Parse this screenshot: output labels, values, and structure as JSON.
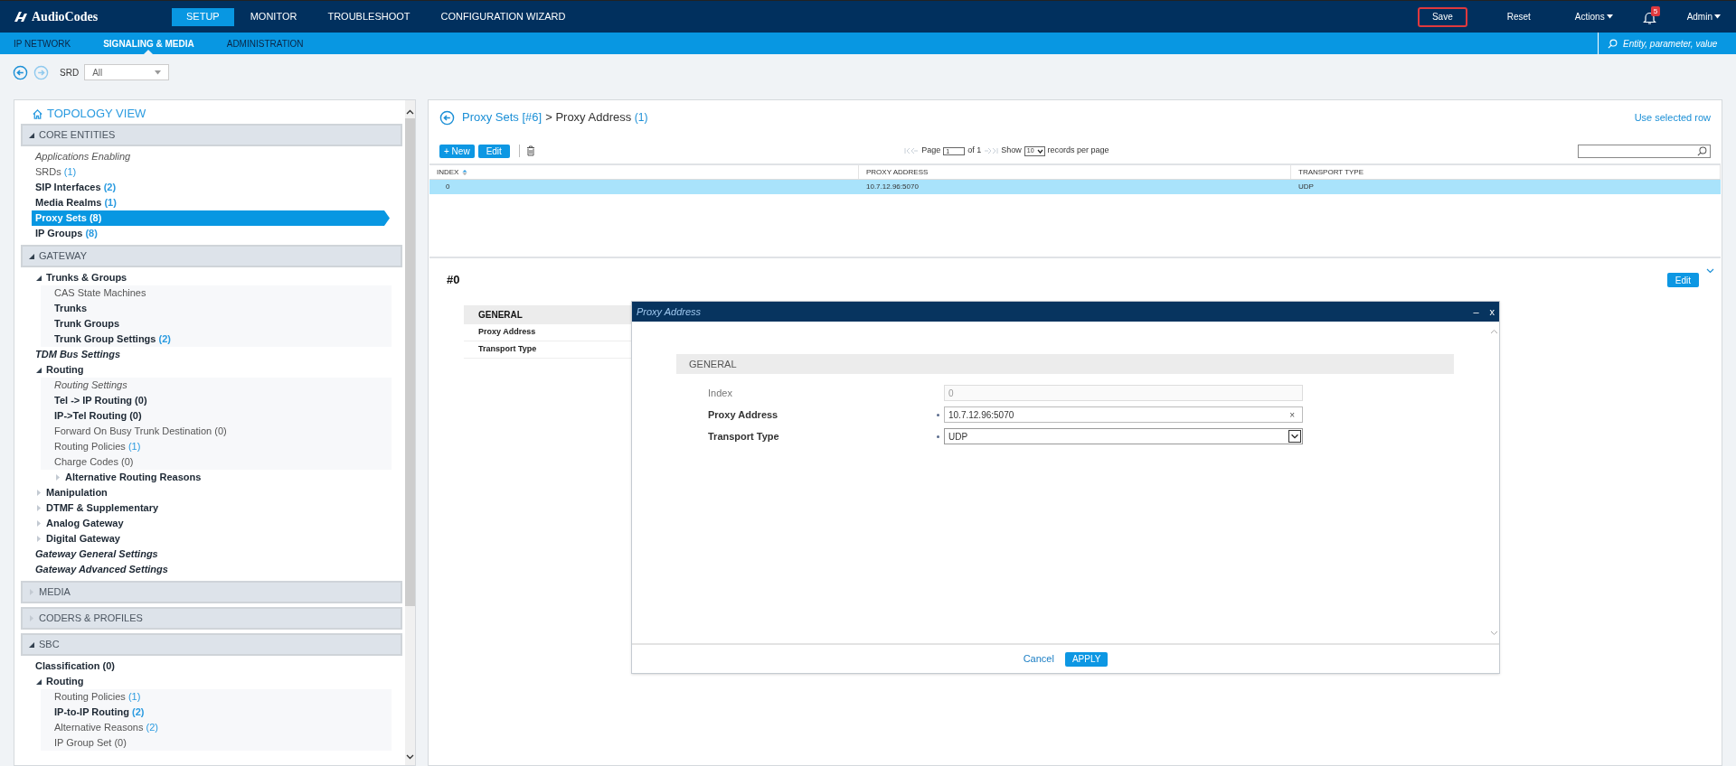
{
  "top_bar": {
    "logo": "AudioCodes",
    "tabs": [
      {
        "label": "SETUP",
        "selected": true
      },
      {
        "label": "MONITOR",
        "selected": false
      },
      {
        "label": "TROUBLESHOOT",
        "selected": false
      },
      {
        "label": "CONFIGURATION WIZARD",
        "selected": false
      }
    ],
    "actions": [
      {
        "label": "Save",
        "kind": "button",
        "outlined": true
      },
      {
        "label": "Reset",
        "kind": "button",
        "outlined": false
      },
      {
        "label": "Actions",
        "kind": "menu",
        "outlined": false
      },
      {
        "label": "5",
        "kind": "bell",
        "outlined": false
      },
      {
        "label": "Admin",
        "kind": "menu",
        "outlined": false
      }
    ]
  },
  "sub_nav": {
    "tabs": [
      {
        "label": "IP NETWORK",
        "selected": false
      },
      {
        "label": "SIGNALING & MEDIA",
        "selected": true
      },
      {
        "label": "ADMINISTRATION",
        "selected": false
      }
    ],
    "search": {
      "placeholder": "Entity, parameter, value"
    }
  },
  "toolbar": {
    "srd_label": "SRD",
    "srd_value": "All"
  },
  "sidebar": {
    "title": "TOPOLOGY VIEW",
    "sections": [
      {
        "label": "CORE ENTITIES",
        "expanded": true,
        "items": [
          {
            "label": "Applications Enabling",
            "kind": "page",
            "selected": false
          },
          {
            "label": "SRDs",
            "count": "(1)",
            "kind": "item",
            "selected": false
          },
          {
            "label": "SIP Interfaces",
            "count": "(2)",
            "kind": "table",
            "selected": false
          },
          {
            "label": "Media Realms",
            "count": "(1)",
            "kind": "table",
            "selected": false
          },
          {
            "label": "Proxy Sets",
            "count": "(8)",
            "kind": "table",
            "selected": true
          },
          {
            "label": "IP Groups",
            "count": "(8)",
            "kind": "table",
            "selected": false
          }
        ]
      },
      {
        "label": "GATEWAY",
        "expanded": true,
        "items": [
          {
            "label": "Trunks & Groups",
            "kind": "table",
            "selected": false,
            "expanded": true,
            "children": [
              {
                "label": "CAS State Machines",
                "kind": "item",
                "selected": false
              },
              {
                "label": "Trunks",
                "kind": "table",
                "selected": false
              },
              {
                "label": "Trunk Groups",
                "kind": "table",
                "selected": false
              },
              {
                "label": "Trunk Group Settings",
                "count": "(2)",
                "kind": "table",
                "selected": false
              }
            ]
          },
          {
            "label": "TDM Bus Settings",
            "kind": "setting",
            "selected": false
          },
          {
            "label": "Routing",
            "kind": "table",
            "selected": false,
            "expanded": true,
            "children": [
              {
                "label": "Routing Settings",
                "kind": "page",
                "selected": false
              },
              {
                "label": "Tel -> IP Routing (0)",
                "kind": "table",
                "selected": false
              },
              {
                "label": "IP->Tel Routing (0)",
                "kind": "table",
                "selected": false
              },
              {
                "label": "Forward On Busy Trunk Destination (0)",
                "kind": "item",
                "selected": false
              },
              {
                "label": "Routing Policies",
                "count": "(1)",
                "kind": "item",
                "selected": false
              },
              {
                "label": "Charge Codes (0)",
                "kind": "item",
                "selected": false
              },
              {
                "label": "Alternative Routing Reasons",
                "kind": "table",
                "selected": false,
                "expanded": false
              }
            ]
          },
          {
            "label": "Manipulation",
            "kind": "table",
            "selected": false,
            "expanded": false
          },
          {
            "label": "DTMF & Supplementary",
            "kind": "table",
            "selected": false,
            "expanded": false
          },
          {
            "label": "Analog Gateway",
            "kind": "table",
            "selected": false,
            "expanded": false
          },
          {
            "label": "Digital Gateway",
            "kind": "table",
            "selected": false,
            "expanded": false
          },
          {
            "label": "Gateway General Settings",
            "kind": "setting",
            "selected": false
          },
          {
            "label": "Gateway Advanced Settings",
            "kind": "setting",
            "selected": false
          }
        ]
      },
      {
        "label": "MEDIA",
        "expanded": false
      },
      {
        "label": "CODERS & PROFILES",
        "expanded": false
      },
      {
        "label": "SBC",
        "expanded": true,
        "items": [
          {
            "label": "Classification (0)",
            "kind": "table",
            "selected": false
          },
          {
            "label": "Routing",
            "kind": "table",
            "selected": false,
            "expanded": true,
            "children": [
              {
                "label": "Routing Policies",
                "count": "(1)",
                "kind": "item",
                "selected": false
              },
              {
                "label": "IP-to-IP Routing",
                "count": "(2)",
                "kind": "table",
                "selected": false
              },
              {
                "label": "Alternative Reasons",
                "count": "(2)",
                "kind": "item",
                "selected": false
              },
              {
                "label": "IP Group Set (0)",
                "kind": "item",
                "selected": false
              }
            ]
          }
        ]
      }
    ]
  },
  "main": {
    "breadcrumb": {
      "parent": "Proxy Sets [#6]",
      "separator": ">",
      "current": "Proxy Address",
      "count": "(1)"
    },
    "use_selected_row": "Use selected row",
    "actions": {
      "new": "+ New",
      "edit": "Edit"
    },
    "pagination": {
      "page_label": "Page",
      "page": "1",
      "of": "of 1",
      "show": "Show",
      "per_page": "10",
      "suffix": "records per page"
    },
    "table": {
      "columns": [
        {
          "label": "INDEX",
          "sorted": true
        },
        {
          "label": "PROXY ADDRESS",
          "sorted": false
        },
        {
          "label": "TRANSPORT TYPE",
          "sorted": false
        }
      ],
      "rows": [
        {
          "cells": [
            "0",
            "10.7.12.96:5070",
            "UDP"
          ],
          "selected": true
        }
      ]
    },
    "detail": {
      "title": "#0",
      "edit": "Edit",
      "nav": [
        {
          "label": "GENERAL",
          "kind": "header"
        },
        {
          "label": "Proxy Address",
          "kind": "link"
        },
        {
          "label": "Transport Type",
          "kind": "link"
        }
      ]
    }
  },
  "dialog": {
    "title": "Proxy Address",
    "minimize": "–",
    "close": "x",
    "section": "GENERAL",
    "fields": [
      {
        "label": "Index",
        "value": "0",
        "kind": "text",
        "required": false,
        "disabled": true
      },
      {
        "label": "Proxy Address",
        "value": "10.7.12.96:5070",
        "kind": "text",
        "required": true,
        "disabled": false,
        "clear": "×"
      },
      {
        "label": "Transport Type",
        "value": "UDP",
        "kind": "select",
        "required": true,
        "disabled": false
      }
    ],
    "cancel": "Cancel",
    "apply": "APPLY"
  }
}
